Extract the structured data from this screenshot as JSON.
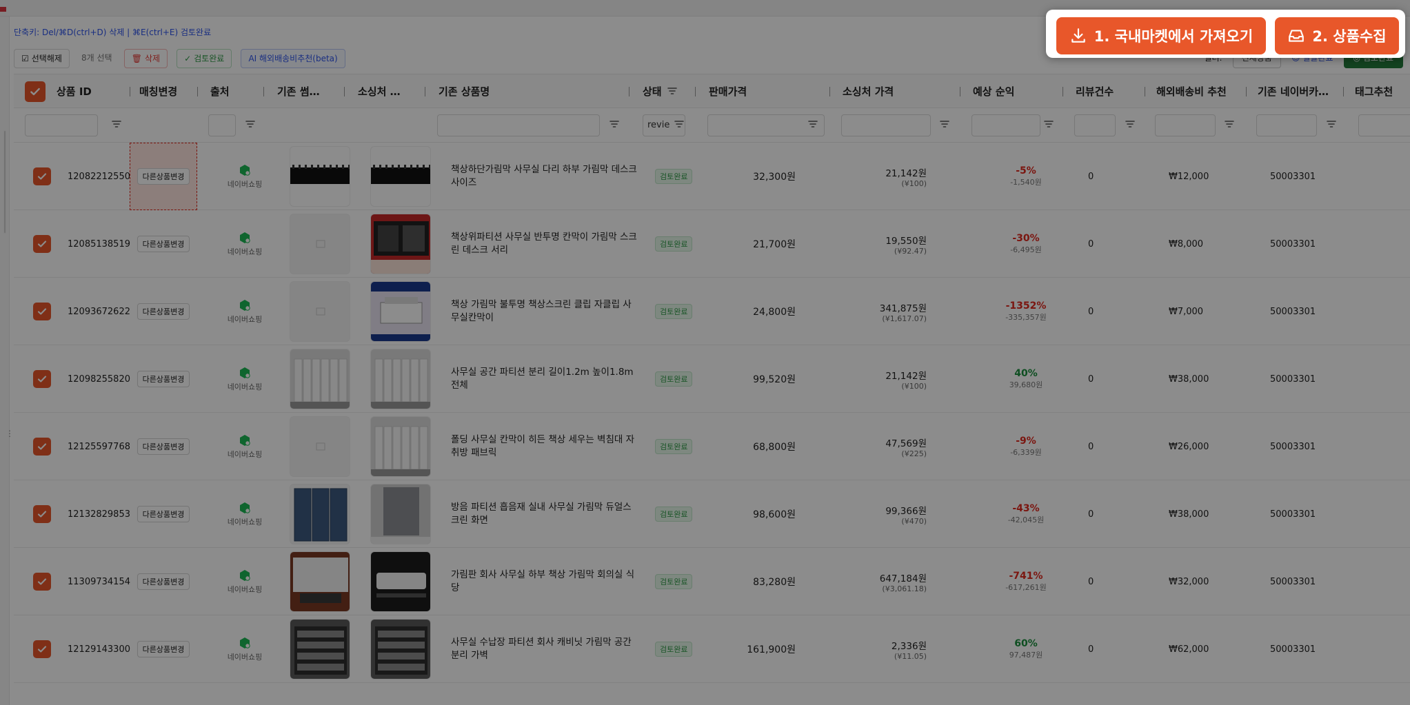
{
  "shortcuts": "단축키: Del/⌘D(ctrl+D) 삭제 | ⌘E(ctrl+E) 검토완료",
  "toolbar": {
    "deselect": "선택해제",
    "selected_count": "8개 선택",
    "delete": "삭제",
    "review_done": "검토완료",
    "ai_shipping": "AI 해외배송비추천(beta)"
  },
  "right_toolbar": {
    "label": "필터:",
    "select": "전체상품",
    "link": "☺ 일괄완료",
    "button": "◎ 검토완료"
  },
  "columns": [
    {
      "key": "id",
      "label": "상품 ID"
    },
    {
      "key": "match",
      "label": "매칭변경"
    },
    {
      "key": "source",
      "label": "출처"
    },
    {
      "key": "old_thumb",
      "label": "기존 썸…"
    },
    {
      "key": "src_thumb",
      "label": "소싱처 …"
    },
    {
      "key": "old_name",
      "label": "기존 상품명"
    },
    {
      "key": "status",
      "label": "상태"
    },
    {
      "key": "sale_price",
      "label": "판매가격"
    },
    {
      "key": "src_price",
      "label": "소싱처 가격"
    },
    {
      "key": "margin",
      "label": "예상 순익"
    },
    {
      "key": "reviews",
      "label": "리뷰건수"
    },
    {
      "key": "shipping",
      "label": "해외배송비 추천"
    },
    {
      "key": "naver_cat",
      "label": "기존 네이버카…"
    },
    {
      "key": "tag",
      "label": "태그추천"
    }
  ],
  "filters": {
    "status_value": "revie"
  },
  "rows": [
    {
      "id": "12082212550",
      "match": "다른상품변경",
      "source": "네이버쇼핑",
      "name": "책상하단가림막 사무실 다리 하부 가림막 데스크 사이즈",
      "status": "검토완료",
      "sale_price": "32,300원",
      "src_price": "21,142원",
      "src_cny": "(¥100)",
      "margin": "-5%",
      "margin_amt": "-1,540원",
      "margin_sign": "neg",
      "reviews": "0",
      "shipping": "₩12,000",
      "category": "50003301",
      "old_img": "panel",
      "src_img": "panel"
    },
    {
      "id": "12085138519",
      "match": "다른상품변경",
      "source": "네이버쇼핑",
      "name": "책상위파티션 사무실 반투명 칸막이 가림막 스크린 데스크 서리",
      "status": "검토완료",
      "sale_price": "21,700원",
      "src_price": "19,550원",
      "src_cny": "(¥92.47)",
      "margin": "-30%",
      "margin_amt": "-6,495원",
      "margin_sign": "neg",
      "reviews": "0",
      "shipping": "₩8,000",
      "category": "50003301",
      "old_img": "blank",
      "src_img": "desk"
    },
    {
      "id": "12093672622",
      "match": "다른상품변경",
      "source": "네이버쇼핑",
      "name": "책상 가림막 불투명 책상스크린 클립 자클립 사무실칸막이",
      "status": "검토완료",
      "sale_price": "24,800원",
      "src_price": "341,875원",
      "src_cny": "(¥1,617.07)",
      "margin": "-1352%",
      "margin_amt": "-335,357원",
      "margin_sign": "neg",
      "reviews": "0",
      "shipping": "₩7,000",
      "category": "50003301",
      "old_img": "blank",
      "src_img": "printer"
    },
    {
      "id": "12098255820",
      "match": "다른상품변경",
      "source": "네이버쇼핑",
      "name": "사무실 공간 파티션 분리 길이1.2m 높이1.8m 전체",
      "status": "검토완료",
      "sale_price": "99,520원",
      "src_price": "21,142원",
      "src_cny": "(¥100)",
      "margin": "40%",
      "margin_amt": "39,680원",
      "margin_sign": "pos",
      "reviews": "0",
      "shipping": "₩38,000",
      "category": "50003301",
      "old_img": "white",
      "src_img": "white"
    },
    {
      "id": "12125597768",
      "match": "다른상품변경",
      "source": "네이버쇼핑",
      "name": "폴딩 사무실 칸막이 히든 책상 세우는 벽침대 자취방 패브릭",
      "status": "검토완료",
      "sale_price": "68,800원",
      "src_price": "47,569원",
      "src_cny": "(¥225)",
      "margin": "-9%",
      "margin_amt": "-6,339원",
      "margin_sign": "neg",
      "reviews": "0",
      "shipping": "₩26,000",
      "category": "50003301",
      "old_img": "blank",
      "src_img": "white"
    },
    {
      "id": "12132829853",
      "match": "다른상품변경",
      "source": "네이버쇼핑",
      "name": "방음 파티션 흡음재 실내 사무실 가림막 듀얼스크린 화면",
      "status": "검토완료",
      "sale_price": "98,600원",
      "src_price": "99,366원",
      "src_cny": "(¥470)",
      "margin": "-43%",
      "margin_amt": "-42,045원",
      "margin_sign": "neg",
      "reviews": "0",
      "shipping": "₩38,000",
      "category": "50003301",
      "old_img": "blue",
      "src_img": "gray"
    },
    {
      "id": "11309734154",
      "match": "다른상품변경",
      "source": "네이버쇼핑",
      "name": "가림판 회사 사무실 하부 책상 가림막 회의실 식당",
      "status": "검토완료",
      "sale_price": "83,280원",
      "src_price": "647,184원",
      "src_cny": "(¥3,061.18)",
      "margin": "-741%",
      "margin_amt": "-617,261원",
      "margin_sign": "neg",
      "reviews": "0",
      "shipping": "₩32,000",
      "category": "50003301",
      "old_img": "wood",
      "src_img": "dark"
    },
    {
      "id": "12129143300",
      "match": "다른상품변경",
      "source": "네이버쇼핑",
      "name": "사무실 수납장 파티션 회사 캐비닛 가림막 공간분리 가벽",
      "status": "검토완료",
      "sale_price": "161,900원",
      "src_price": "2,336원",
      "src_cny": "(¥11.05)",
      "margin": "60%",
      "margin_amt": "97,487원",
      "margin_sign": "pos",
      "reviews": "0",
      "shipping": "₩62,000",
      "category": "50003301",
      "old_img": "shelf",
      "src_img": "shelf"
    }
  ],
  "popup": {
    "import_button": "1. 국내마켓에서 가져오기",
    "collect_button": "2. 상품수집"
  },
  "colors": {
    "accent": "#e8572a",
    "positive": "#1a8f3c",
    "negative": "#e0281e",
    "review_badge": "#2e9a46"
  }
}
